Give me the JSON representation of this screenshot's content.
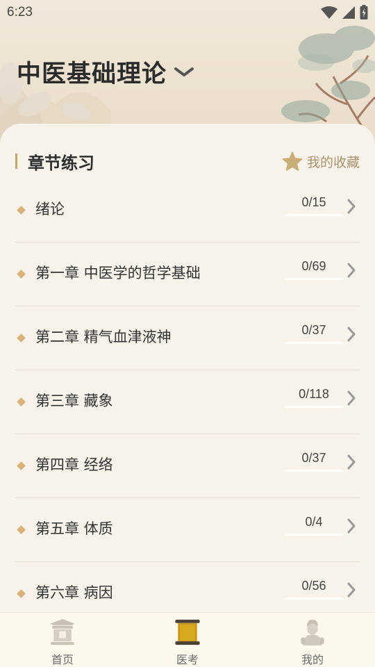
{
  "status_bar": {
    "time": "6:23"
  },
  "header": {
    "title": "中医基础理论"
  },
  "section": {
    "title": "章节练习",
    "favorites_label": "我的收藏"
  },
  "chapters": [
    {
      "name": "绪论",
      "progress": "0/15"
    },
    {
      "name": "第一章 中医学的哲学基础",
      "progress": "0/69"
    },
    {
      "name": "第二章 精气血津液神",
      "progress": "0/37"
    },
    {
      "name": "第三章 藏象",
      "progress": "0/118"
    },
    {
      "name": "第四章 经络",
      "progress": "0/37"
    },
    {
      "name": "第五章 体质",
      "progress": "0/4"
    },
    {
      "name": "第六章 病因",
      "progress": "0/56"
    }
  ],
  "bottom_nav": [
    {
      "label": "首页",
      "icon": "pavilion-icon",
      "active": false
    },
    {
      "label": "医考",
      "icon": "scroll-icon",
      "active": true
    },
    {
      "label": "我的",
      "icon": "doctor-icon",
      "active": false
    }
  ],
  "colors": {
    "accent_gold": "#c7a46b",
    "favorites_text": "#a9946f",
    "card_bg": "#f7f3ea",
    "nav_bg": "#fcf8ec"
  }
}
